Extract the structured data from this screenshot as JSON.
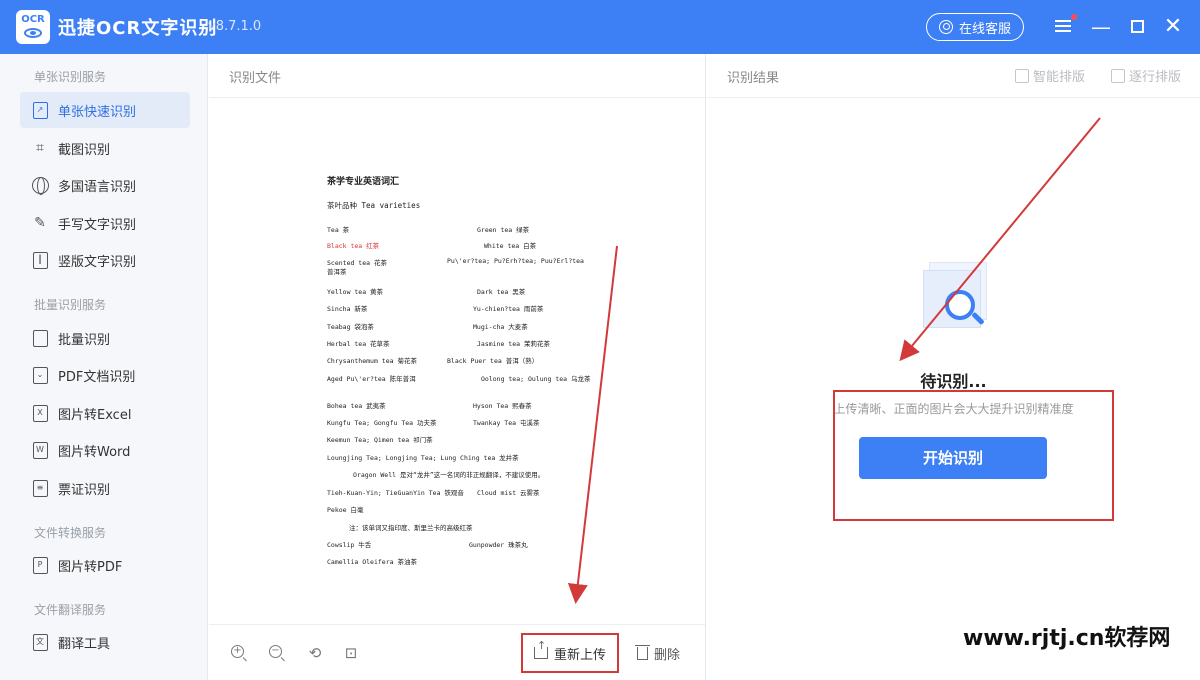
{
  "app": {
    "logo_text": "OCR",
    "title": "迅捷OCR文字识别",
    "version": "v8.7.1.0",
    "service_label": "在线客服"
  },
  "sidebar": {
    "groups": [
      {
        "title": "单张识别服务",
        "items": [
          "单张快速识别",
          "截图识别",
          "多国语言识别",
          "手写文字识别",
          "竖版文字识别"
        ]
      },
      {
        "title": "批量识别服务",
        "items": [
          "批量识别",
          "PDF文档识别",
          "图片转Excel",
          "图片转Word",
          "票证识别"
        ]
      },
      {
        "title": "文件转换服务",
        "items": [
          "图片转PDF"
        ]
      },
      {
        "title": "文件翻译服务",
        "items": [
          "翻译工具"
        ]
      }
    ],
    "active_item": "单张快速识别"
  },
  "middle": {
    "title": "识别文件",
    "document": {
      "heading": "茶学专业英语词汇",
      "subheading": "茶叶品种 Tea varieties",
      "rows": [
        {
          "a": "Tea 茶",
          "b": "Green tea 绿茶"
        },
        {
          "a": "Black tea 红茶",
          "b": "White tea 白茶"
        },
        {
          "a": "Scented tea 花茶",
          "b": "Pu\\'er?tea; Pu?Erh?tea; Puu?Erl?tea"
        },
        {
          "a": "普洱茶",
          "b": ""
        },
        {
          "a": "Yellow tea 黄茶",
          "b": "Dark tea 黑茶"
        },
        {
          "a": "Sincha 新茶",
          "b": "Yu-chien?tea 雨前茶"
        },
        {
          "a": "Teabag 袋泡茶",
          "b": "Mugi-cha 大麦茶"
        },
        {
          "a": "Herbal tea 花草茶",
          "b": "Jasmine tea 茉莉花茶"
        },
        {
          "a": "Chrysanthemum tea 菊花茶",
          "b": "Black Puer tea 普洱（熟）"
        },
        {
          "a": "Aged Pu\\'er?tea 陈年普洱",
          "b": "Oolong tea; Oulung tea 乌龙茶"
        },
        {
          "a": "Bohea tea 武夷茶",
          "b": "Hyson Tea 熙春茶"
        },
        {
          "a": "Kungfu Tea; Gongfu Tea 功夫茶",
          "b": "Twankay Tea 屯溪茶"
        },
        {
          "a": "Keemun Tea; Qimen tea 祁门茶",
          "b": ""
        },
        {
          "a": "Loungjing Tea;  Longjing Tea; Lung Ching tea 龙井茶",
          "b": ""
        },
        {
          "a": "Oragon Well 是对“龙井”这一名词的非正规翻译，不建议使用。",
          "b": ""
        },
        {
          "a": "Tieh-Kuan-Yin; TieGuanYin Tea 铁观音",
          "b": "Cloud mist 云雾茶"
        },
        {
          "a": "Pekoe 白毫",
          "b": ""
        },
        {
          "a": "注：该单词又指印度、斯里兰卡的高级红茶",
          "b": ""
        },
        {
          "a": "Cowslip 牛舌",
          "b": "Gunpowder 珠茶丸"
        },
        {
          "a": "Camellia Oleifera 茶油茶",
          "b": ""
        }
      ]
    },
    "footer": {
      "reupload_label": "重新上传",
      "delete_label": "删除"
    }
  },
  "right": {
    "title": "识别结果",
    "smart_layout_label": "智能排版",
    "line_layout_label": "逐行排版",
    "waiting_title": "待识别...",
    "waiting_subtitle": "上传清晰、正面的图片会大大提升识别精准度",
    "start_label": "开始识别"
  },
  "watermark": "www.rjtj.cn软荐网",
  "colors": {
    "brand_blue": "#3d7ff5",
    "annotation_red": "#d23a3a"
  }
}
